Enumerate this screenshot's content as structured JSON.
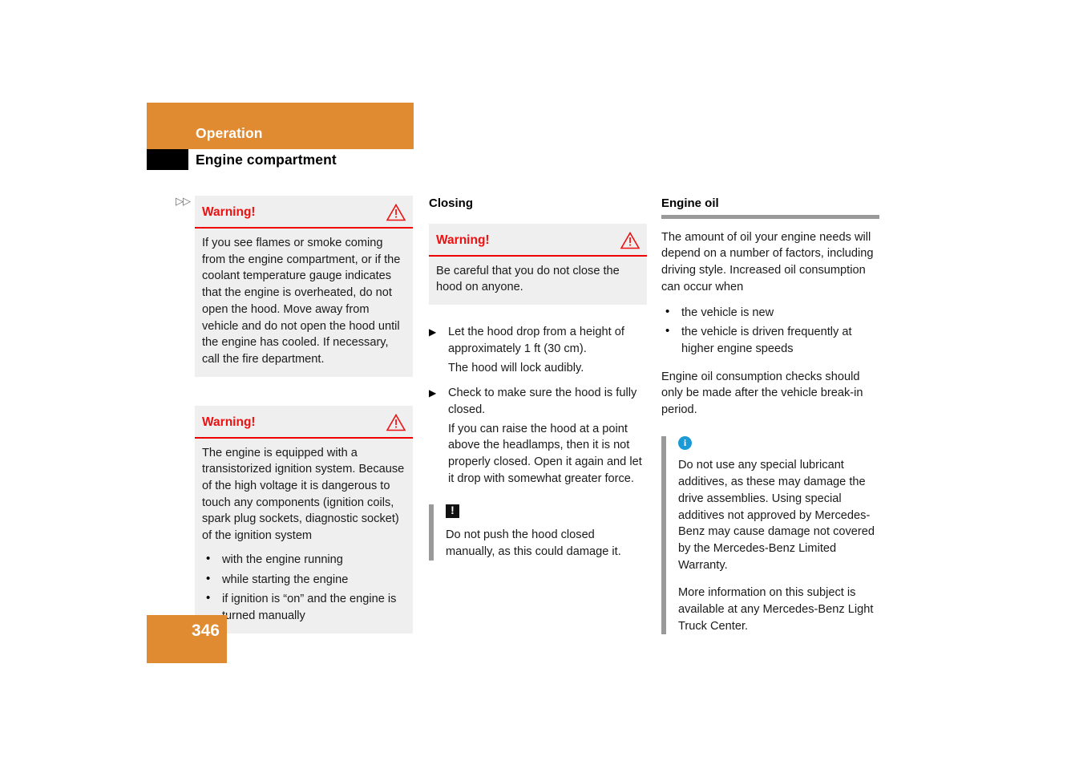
{
  "header": {
    "band_title": "Operation",
    "subtitle": "Engine compartment"
  },
  "continuation_markers": "▷▷",
  "columns": {
    "left": {
      "warning_1": {
        "title": "Warning!",
        "icon": "warning-triangle-icon",
        "body": "If you see flames or smoke coming from the engine compartment, or if the coolant temperature gauge indicates that the engine is overheated, do not open the hood. Move away from vehicle and do not open the hood until the engine has cooled. If necessary, call the fire department."
      },
      "warning_2": {
        "title": "Warning!",
        "icon": "warning-triangle-icon",
        "body": "The engine is equipped with a transistorized ignition system. Because of the high voltage it is dangerous to touch any components (ignition coils, spark plug sockets, diagnostic socket) of the ignition system",
        "bullets": [
          "with the engine running",
          "while starting the engine",
          "if ignition is “on” and the engine is turned manually"
        ]
      }
    },
    "middle": {
      "section_title": "Closing",
      "warning": {
        "title": "Warning!",
        "icon": "warning-triangle-icon",
        "body": "Be careful that you do not close the hood on anyone."
      },
      "steps": [
        {
          "action": "Let the hood drop from a height of approximately 1 ft (30 cm).",
          "result": "The hood will lock audibly."
        },
        {
          "action": "Check to make sure the hood is fully closed.",
          "result": "If you can raise the hood at a point above the headlamps, then it is not properly closed. Open it again and let it drop with somewhat greater force."
        }
      ],
      "note": {
        "icon": "exclamation-box-icon",
        "icon_glyph": "!",
        "body": "Do not push the hood closed manually, as this could damage it."
      }
    },
    "right": {
      "section_title": "Engine oil",
      "intro": "The amount of oil your engine needs will depend on a number of factors, including driving style. Increased oil consumption can occur when",
      "bullets": [
        "the vehicle is new",
        "the vehicle is driven frequently at higher engine speeds"
      ],
      "outro": "Engine oil consumption checks should only be made after the vehicle break-in period.",
      "note": {
        "icon": "info-circle-icon",
        "icon_glyph": "i",
        "paragraph_1": "Do not use any special lubricant additives, as these may damage the drive assemblies. Using special additives not approved by Mercedes-Benz may cause damage not covered by the Mercedes-Benz Limited Warranty.",
        "paragraph_2": "More information on this subject is available at any Mercedes-Benz Light Truck Center."
      }
    }
  },
  "footer": {
    "page_number": "346"
  },
  "colors": {
    "accent_orange": "#e08a32",
    "warning_red": "#ee1111",
    "box_gray": "#efefef",
    "rule_gray": "#9a9a9a",
    "info_blue": "#1c9ad6"
  }
}
